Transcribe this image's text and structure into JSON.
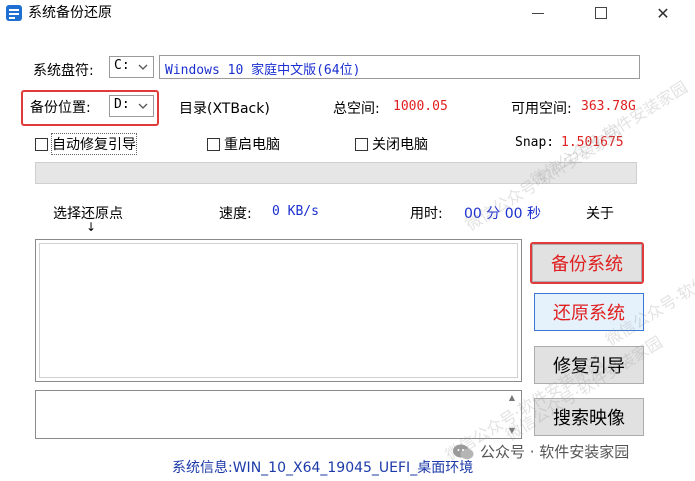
{
  "window": {
    "title": "系统备份还原"
  },
  "system_drive": {
    "label": "系统盘符:",
    "value": "C:",
    "os_description": "Windows 10 家庭中文版(64位)"
  },
  "backup_location": {
    "label": "备份位置:",
    "value": "D:"
  },
  "directory": {
    "text": "目录(XTBack)"
  },
  "total_space": {
    "label": "总空间:",
    "value": "1000.05"
  },
  "free_space": {
    "label": "可用空间:",
    "value": "363.78G"
  },
  "options": {
    "auto_repair_boot": "自动修复引导",
    "restart": "重启电脑",
    "shutdown": "关闭电脑"
  },
  "snap": {
    "label": "Snap:",
    "value": "1.501675"
  },
  "status": {
    "restore_point_label": "选择还原点",
    "arrow": "↓",
    "speed_label": "速度:",
    "speed_value": "0 KB/s",
    "time_label": "用时:",
    "time_value": "00 分 00 秒",
    "about": "关于"
  },
  "buttons": {
    "backup": "备份系统",
    "restore": "还原系统",
    "repair_boot": "修复引导",
    "search_image": "搜索映像"
  },
  "footer": {
    "system_info": "系统信息:WIN_10_X64_19045_UEFI_桌面环境"
  },
  "watermarks": [
    "微信公众号·软件安装家园",
    "微信公众号·软件安装家园",
    "微信公众号·软件安装家园",
    "微信公众号·软件安装家园",
    "微信公众号·软件安装家园"
  ],
  "badge": {
    "text": "公众号 · 软件安装家园"
  },
  "colors": {
    "accent_red": "#e02020",
    "value_blue": "#1a2fd0",
    "highlight_border": "#e03a3a"
  }
}
